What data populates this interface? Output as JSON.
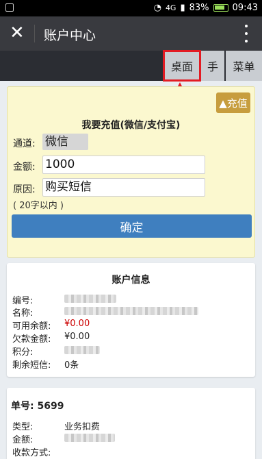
{
  "status_bar": {
    "network": "4G",
    "battery_percent": "83%",
    "time": "09:43"
  },
  "header": {
    "close_icon": "close-icon",
    "title": "账户中心",
    "more_icon": "more-vertical-icon"
  },
  "nav": {
    "desktop": "桌面",
    "hand": "手",
    "menu": "菜单"
  },
  "recharge": {
    "toggle_button": "▲充值",
    "title": "我要充值(微信/支付宝)",
    "channel_label": "通道:",
    "channel_value": "微信",
    "amount_label": "金额:",
    "amount_value": "1000",
    "reason_label": "原因:",
    "reason_value": "购买短信",
    "note": "( 20字以内 )",
    "confirm": "确定"
  },
  "account": {
    "title": "账户信息",
    "number_label": "编号:",
    "name_label": "名称:",
    "available_label": "可用余额:",
    "available_value": "¥0.00",
    "debt_label": "欠款金额:",
    "debt_value": "¥0.00",
    "points_label": "积分:",
    "sms_left_label": "剩余短信:",
    "sms_left_value": "0条"
  },
  "order": {
    "number": "单号: 5699",
    "type_label": "类型:",
    "type_value": "业务扣费",
    "amount_label": "金额:",
    "method_label": "收款方式:"
  },
  "colors": {
    "highlight": "#e31b23",
    "confirm": "#3f7fbf",
    "recharge_toggle": "#c79d3e",
    "negative_value": "#cc0000"
  }
}
